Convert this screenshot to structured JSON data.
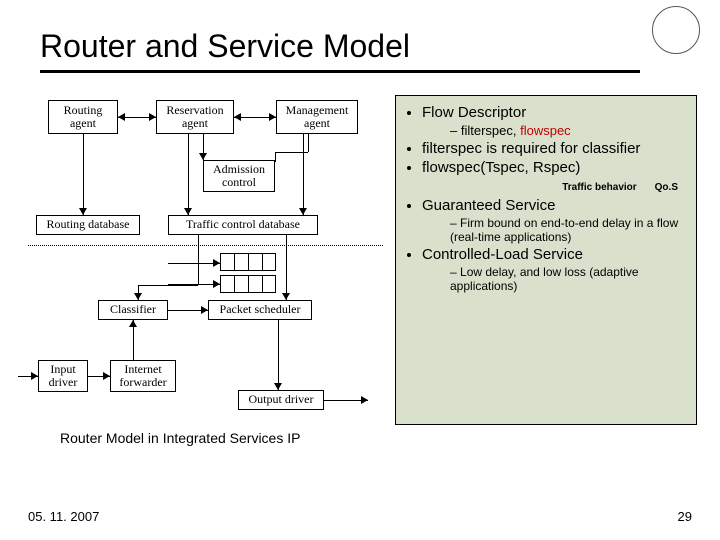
{
  "title": "Router and Service Model",
  "logo_text": "",
  "diagram": {
    "routing_agent": "Routing\nagent",
    "reservation_agent": "Reservation\nagent",
    "management_agent": "Management\nagent",
    "admission_control": "Admission\ncontrol",
    "routing_database": "Routing database",
    "traffic_db": "Traffic control database",
    "classifier": "Classifier",
    "packet_scheduler": "Packet scheduler",
    "input_driver": "Input\ndriver",
    "internet_forwarder": "Internet\nforwarder",
    "output_driver": "Output driver"
  },
  "caption": "Router Model in Integrated Services IP",
  "panel": {
    "b1": "Flow Descriptor",
    "b1s_plain": "filterspec, ",
    "b1s_red": "flowspec",
    "b2": "filterspec is required for classifier",
    "b3": "flowspec(Tspec, Rspec)",
    "tiny_left": "Traffic behavior",
    "tiny_right": "Qo.S",
    "b4": "Guaranteed Service",
    "b4s": "Firm bound on end-to-end delay in a flow (real-time applications)",
    "b5": "Controlled-Load Service",
    "b5s": "Low delay, and low loss (adaptive applications)"
  },
  "footer": {
    "date": "05. 11. 2007",
    "page": "29"
  }
}
